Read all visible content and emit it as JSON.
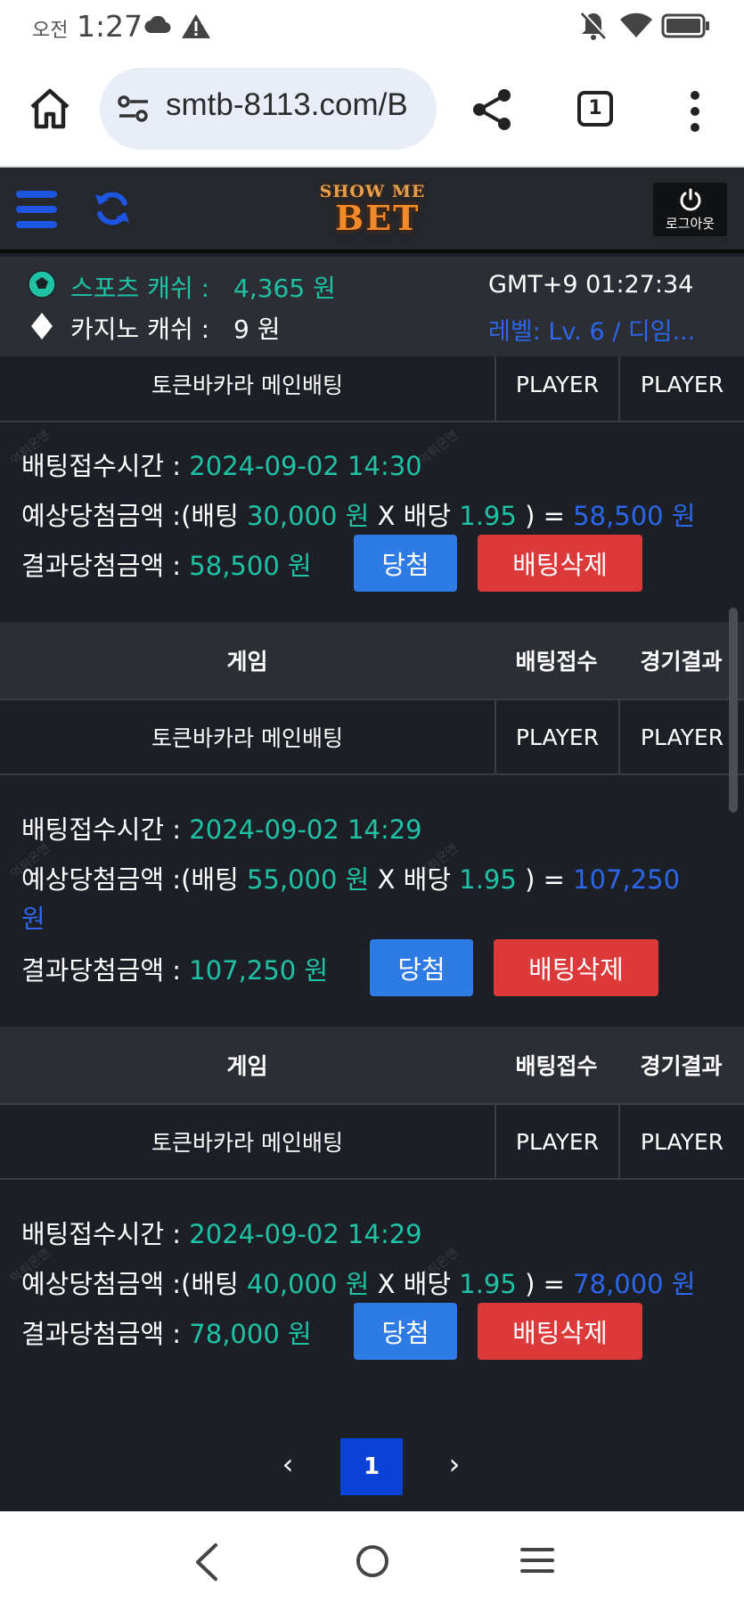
{
  "status_bar": {
    "ampm": "오전",
    "time": "1:27"
  },
  "browser": {
    "url": "smtb-8113.com/B",
    "tab_count": "1"
  },
  "site_header": {
    "logo_top": "SHOW ME",
    "logo_main": "BET",
    "logout_label": "로그아웃",
    "accent_color": "#1d55e0"
  },
  "info": {
    "sports_label": "스포츠 캐쉬 :",
    "sports_value": "4,365 원",
    "casino_label": "카지노 캐쉬 :",
    "casino_value": "9 원",
    "time": "GMT+9 01:27:34",
    "level": "레벨: Lv. 6 / 디임..."
  },
  "table_headers": {
    "game": "게임",
    "bet_received": "배팅접수",
    "result": "경기결과"
  },
  "bets": [
    {
      "game": "토큰바카라 메인배팅",
      "pick": "PLAYER",
      "result": "PLAYER",
      "time_label": "배팅접수시간 :",
      "time": "2024-09-02 14:30",
      "expected_label": "예상당첨금액 :",
      "open": "(배팅",
      "stake": "30,000 원",
      "x": "X",
      "odds_label": "배당",
      "odds": "1.95",
      "close": ") =",
      "expected": "58,500 원",
      "result_label": "결과당첨금액 :",
      "result_amount": "58,500 원",
      "win_button": "당첨",
      "delete_button": "배팅삭제"
    },
    {
      "game": "토큰바카라 메인배팅",
      "pick": "PLAYER",
      "result": "PLAYER",
      "time_label": "배팅접수시간 :",
      "time": "2024-09-02 14:29",
      "expected_label": "예상당첨금액 :",
      "open": "(배팅",
      "stake": "55,000 원",
      "x": "X",
      "odds_label": "배당",
      "odds": "1.95",
      "close": ") =",
      "expected": "107,250",
      "expected_unit": "원",
      "result_label": "결과당첨금액 :",
      "result_amount": "107,250 원",
      "win_button": "당첨",
      "delete_button": "배팅삭제"
    },
    {
      "game": "토큰바카라 메인배팅",
      "pick": "PLAYER",
      "result": "PLAYER",
      "time_label": "배팅접수시간 :",
      "time": "2024-09-02 14:29",
      "expected_label": "예상당첨금액 :",
      "open": "(배팅",
      "stake": "40,000 원",
      "x": "X",
      "odds_label": "배당",
      "odds": "1.95",
      "close": ") =",
      "expected": "78,000 원",
      "result_label": "결과당첨금액 :",
      "result_amount": "78,000 원",
      "win_button": "당첨",
      "delete_button": "배팅삭제"
    }
  ],
  "pagination": {
    "prev": "‹",
    "current": "1",
    "next": "›"
  }
}
